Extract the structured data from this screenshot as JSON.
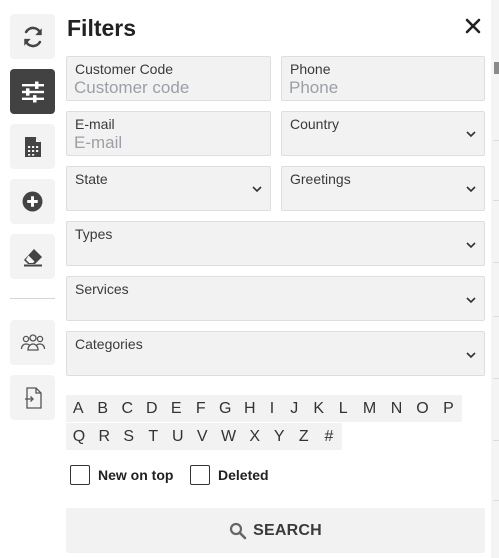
{
  "sidebar": {
    "items": [
      {
        "icon": "refresh-icon"
      },
      {
        "icon": "filter-sliders-icon",
        "active": true
      },
      {
        "icon": "calculator-file-icon"
      },
      {
        "icon": "add-circle-icon"
      },
      {
        "icon": "eraser-icon"
      },
      {
        "icon": "users-group-icon"
      },
      {
        "icon": "file-import-icon"
      }
    ]
  },
  "panel": {
    "title": "Filters",
    "fields": {
      "customer_code": {
        "label": "Customer Code",
        "placeholder": "Customer code",
        "value": ""
      },
      "phone": {
        "label": "Phone",
        "placeholder": "Phone",
        "value": ""
      },
      "email": {
        "label": "E-mail",
        "placeholder": "E-mail",
        "value": ""
      },
      "country": {
        "label": "Country",
        "selected": ""
      },
      "state": {
        "label": "State",
        "selected": ""
      },
      "greetings": {
        "label": "Greetings",
        "selected": ""
      },
      "types": {
        "label": "Types",
        "selected": ""
      },
      "services": {
        "label": "Services",
        "selected": ""
      },
      "categories": {
        "label": "Categories",
        "selected": ""
      }
    },
    "letters_row1": [
      "A",
      "B",
      "C",
      "D",
      "E",
      "F",
      "G",
      "H",
      "I",
      "J",
      "K",
      "L",
      "M",
      "N",
      "O",
      "P"
    ],
    "letters_row2": [
      "Q",
      "R",
      "S",
      "T",
      "U",
      "V",
      "W",
      "X",
      "Y",
      "Z",
      "#"
    ],
    "checkboxes": {
      "new_on_top": {
        "label": "New on top",
        "checked": false
      },
      "deleted": {
        "label": "Deleted",
        "checked": false
      }
    },
    "search_label": "SEARCH"
  },
  "colors": {
    "active_sidebar": "#424242",
    "field_bg": "#f2f2f2",
    "placeholder": "#9aa0a6"
  }
}
